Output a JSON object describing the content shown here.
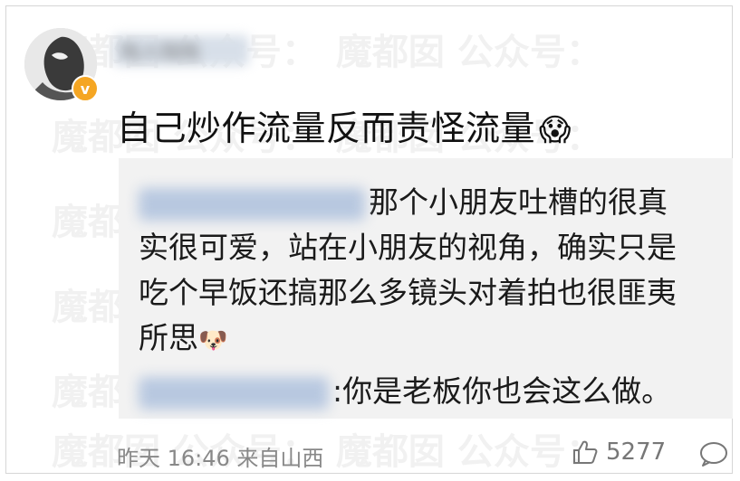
{
  "post": {
    "username": "陆人陆陆",
    "verified_badge": "v",
    "comment_text": "自己炒作流量反而责怪流量",
    "comment_emoji": "😱"
  },
  "reply": {
    "line1_suffix": "那个小朋友吐槽的很真",
    "line2": "实很可爱，站在小朋友的视角，确实只是",
    "line3": "吃个早饭还搞那么多镜头对着拍也很匪夷",
    "line4": "所思",
    "line4_emoji": "🐶",
    "second_reply_suffix": ":你是老板你也会这么做。"
  },
  "footer": {
    "meta": "昨天 16:46 来自山西",
    "likes": "5277"
  },
  "watermark": "魔都囡 公众号："
}
